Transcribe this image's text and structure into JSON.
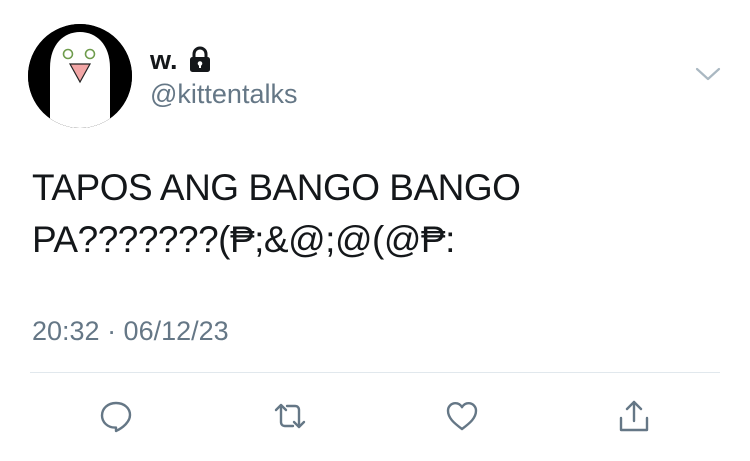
{
  "user": {
    "display_name": "w.",
    "handle": "@kittentalks",
    "protected": true
  },
  "tweet": {
    "lines": [
      "TAPOS ANG BANGO BANGO",
      "PA???????(₱;&@;@(@₱:"
    ],
    "timestamp": "20:32 · 06/12/23"
  },
  "icons": {
    "lock": "lock-icon",
    "caret": "chevron-down-icon",
    "reply": "reply-icon",
    "retweet": "retweet-icon",
    "like": "like-icon",
    "share": "share-icon"
  },
  "colors": {
    "text_primary": "#14171a",
    "text_secondary": "#657786",
    "icon_gray": "#657786",
    "divider": "#e1e8ed"
  }
}
